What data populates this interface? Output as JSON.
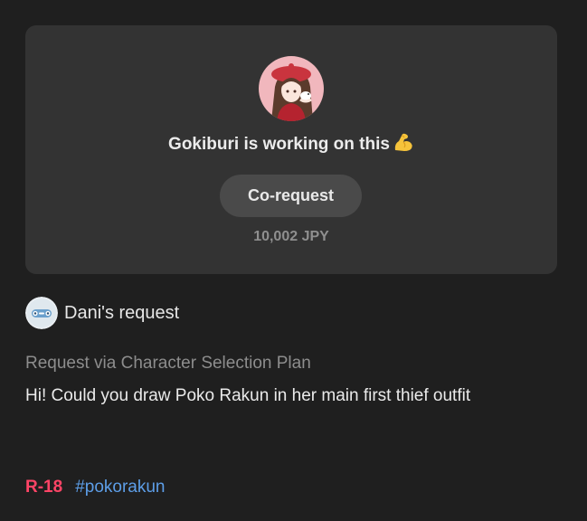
{
  "status_card": {
    "creator_avatar_alt": "Gokiburi avatar",
    "status_text": "Gokiburi is working on this",
    "status_emoji_icon": "flexed-biceps-icon",
    "corequest_label": "Co-request",
    "amount": "10,002 JPY"
  },
  "request": {
    "requester_name": "Dani's request",
    "plan_label": "Request via Character Selection Plan",
    "message": "Hi! Could you draw Poko Rakun in her main first thief outfit"
  },
  "tags": {
    "rating": "R-18",
    "hashtag": "#pokorakun"
  },
  "colors": {
    "background": "#1f1f1f",
    "card": "#333333",
    "button": "#4a4a4a",
    "rating": "#ff4466",
    "hashtag": "#5d9ee8"
  }
}
